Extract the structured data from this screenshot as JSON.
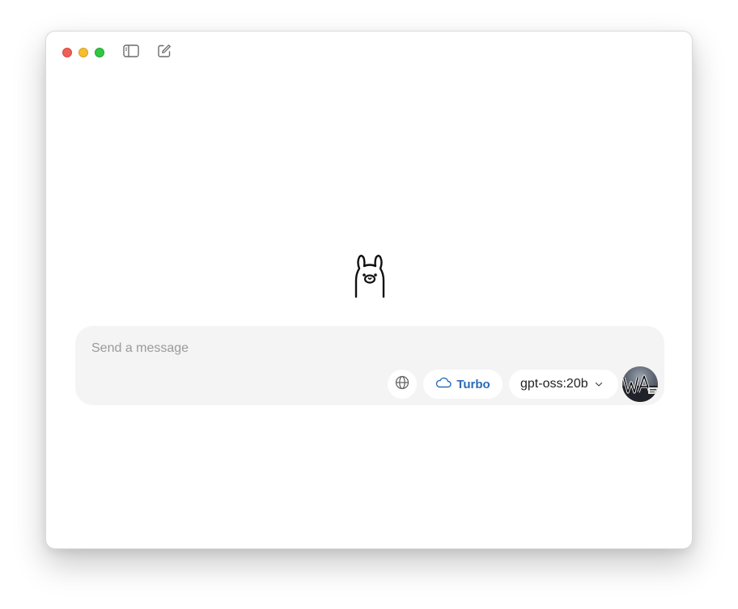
{
  "window": {
    "controls": [
      "close",
      "minimize",
      "maximize"
    ],
    "toolbar": {
      "sidebar_icon": "sidebar-toggle-icon",
      "compose_icon": "new-chat-icon"
    }
  },
  "main": {
    "mascot_icon": "llama-logo-icon"
  },
  "composer": {
    "placeholder": "Send a message",
    "value": "",
    "web_search_icon": "globe-icon",
    "turbo": {
      "icon": "cloud-icon",
      "label": "Turbo",
      "color": "#2a6cb7"
    },
    "model": {
      "label": "gpt-oss:20b",
      "icon": "chevron-down-icon"
    },
    "avatar_icon": "user-avatar"
  },
  "colors": {
    "close": "#ee5f57",
    "minimize": "#f6bd2f",
    "maximize": "#2fc840",
    "composer_bg": "#f4f4f4"
  }
}
